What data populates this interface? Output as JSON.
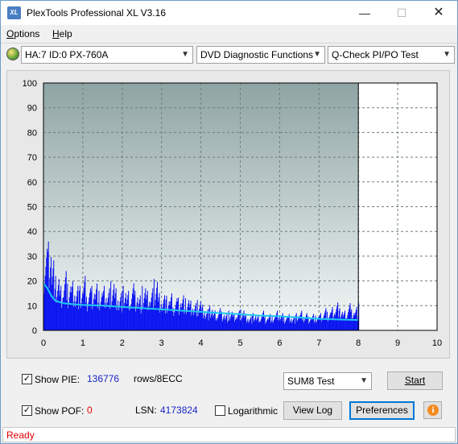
{
  "window": {
    "title": "PlexTools Professional XL V3.16",
    "app_icon_text": "XL",
    "minimize": "—",
    "maximize": "☐",
    "close": "✕"
  },
  "menu": [
    {
      "label": "Options",
      "accel": "O",
      "rest": "ptions"
    },
    {
      "label": "Help",
      "accel": "H",
      "rest": "elp"
    }
  ],
  "toolbar": {
    "drive": "HA:7 ID:0  PX-760A",
    "function": "DVD Diagnostic Functions",
    "test": "Q-Check PI/PO Test"
  },
  "chart_data": {
    "type": "bar",
    "title": "",
    "xlabel": "",
    "ylabel": "",
    "xlim": [
      0,
      10
    ],
    "ylim": [
      0,
      100
    ],
    "x_ticks": [
      0,
      1,
      2,
      3,
      4,
      5,
      6,
      7,
      8,
      9,
      10
    ],
    "y_ticks": [
      0,
      10,
      20,
      30,
      40,
      50,
      60,
      70,
      80,
      90,
      100
    ],
    "grid": true,
    "scan_end_x": 8.0,
    "colors": {
      "bars": "#0a14f0",
      "average": "#1ec8f0",
      "plot_bg_top": "#8fa4a4",
      "plot_bg_bottom": "#f4f8f8"
    },
    "series": [
      {
        "kind": "bars",
        "x": [
          0.0,
          0.1,
          0.2,
          0.3,
          0.4,
          0.5,
          0.6,
          0.7,
          0.8,
          0.9,
          1.0,
          1.1,
          1.2,
          1.3,
          1.4,
          1.5,
          1.6,
          1.7,
          1.8,
          1.9,
          2.0,
          2.1,
          2.2,
          2.3,
          2.4,
          2.5,
          2.6,
          2.7,
          2.8,
          2.9,
          3.0,
          3.1,
          3.2,
          3.3,
          3.4,
          3.5,
          3.6,
          3.7,
          3.8,
          3.9,
          4.0,
          4.1,
          4.2,
          4.3,
          4.4,
          4.5,
          4.6,
          4.7,
          4.8,
          4.9,
          5.0,
          5.1,
          5.2,
          5.3,
          5.4,
          5.5,
          5.6,
          5.7,
          5.8,
          5.9,
          6.0,
          6.1,
          6.2,
          6.3,
          6.4,
          6.5,
          6.6,
          6.7,
          6.8,
          6.9,
          7.0,
          7.1,
          7.2,
          7.3,
          7.4,
          7.5,
          7.6,
          7.7,
          7.8,
          7.9,
          8.0
        ],
        "values": [
          33,
          38,
          30,
          22,
          18,
          24,
          20,
          21,
          19,
          18,
          22,
          17,
          19,
          20,
          16,
          18,
          17,
          21,
          18,
          16,
          18,
          16,
          19,
          17,
          15,
          18,
          16,
          17,
          22,
          16,
          15,
          14,
          15,
          13,
          14,
          15,
          13,
          12,
          11,
          13,
          11,
          9,
          10,
          8,
          9,
          8,
          7,
          8,
          7,
          8,
          9,
          7,
          6,
          7,
          6,
          8,
          6,
          7,
          6,
          8,
          7,
          6,
          7,
          6,
          7,
          8,
          7,
          6,
          7,
          6,
          7,
          9,
          8,
          10,
          12,
          9,
          8,
          11,
          9,
          10,
          11
        ]
      },
      {
        "kind": "average",
        "x": [
          0.0,
          0.1,
          0.2,
          0.3,
          0.5,
          0.8,
          1.0,
          1.5,
          2.0,
          2.5,
          3.0,
          3.5,
          4.0,
          4.5,
          5.0,
          5.5,
          6.0,
          6.5,
          7.0,
          7.5,
          8.0
        ],
        "values": [
          19,
          17,
          14,
          12,
          11,
          10.5,
          10.3,
          10,
          9.5,
          9,
          8.5,
          8,
          7.5,
          7,
          6.5,
          6,
          5.7,
          5.2,
          4.7,
          4.4,
          4.2
        ]
      }
    ]
  },
  "controls": {
    "show_pie_label": "Show PIE:",
    "show_pie_value": "136776",
    "show_pie_unit": "rows/8ECC",
    "show_pof_label": "Show POF:",
    "show_pof_value": "0",
    "lsn_label": "LSN:",
    "lsn_value": "4173824",
    "logarithmic_label": "Logarithmic",
    "sum8_test": "SUM8 Test",
    "start_button": "Start",
    "view_log_button": "View Log",
    "preferences_button": "Preferences",
    "info_glyph": "i",
    "checkmark": "✓",
    "show_pie_checked": true,
    "show_pof_checked": true,
    "logarithmic_checked": false
  },
  "status": {
    "text": "Ready"
  }
}
